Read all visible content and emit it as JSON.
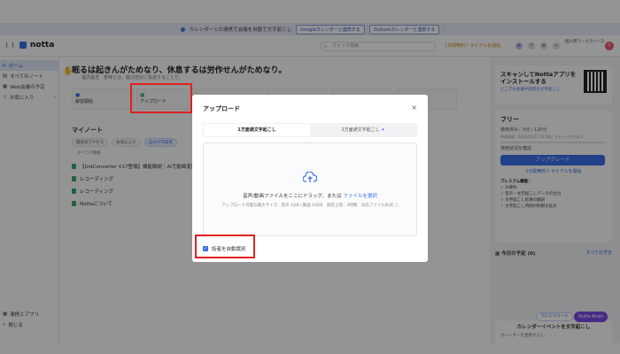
{
  "banner": {
    "text": "カレンダーとの連携で会議を自動で文字起こし",
    "google_btn": "Googleカレンダーと連携する",
    "outlook_btn": "Outlookカレンダーと連携する"
  },
  "topbar": {
    "logo": "notta",
    "search_placeholder": "クイック検索",
    "trial": "1日間無料トライアルを開始",
    "team": "個人用ワークスペース",
    "avatar_letter": "Y"
  },
  "sidebar": {
    "items": [
      {
        "label": "ホーム",
        "icon": "home-icon"
      },
      {
        "label": "すべてのノート",
        "icon": "notes-icon"
      },
      {
        "label": "Web会議の予定",
        "icon": "calendar-icon"
      },
      {
        "label": "お気に入り",
        "icon": "star-icon"
      }
    ],
    "bottom": [
      {
        "label": "連携とアプリ",
        "icon": "apps-icon"
      },
      {
        "label": "閉じる",
        "icon": "collapse-icon"
      }
    ]
  },
  "main": {
    "quote": "眠るは起きんがためなり、休息するは労作せんがためなり。",
    "quote_sub": "福沢諭吉　意味とは、遊び自分に投資することだ。",
    "actions": [
      {
        "label": "録音開始",
        "icon": "mic-icon"
      },
      {
        "label": "アップロード",
        "icon": "upload-icon"
      }
    ],
    "my_notes_title": "マイノート",
    "filters": [
      "最近のアクセス",
      "お気に入り",
      "自分が作成者"
    ],
    "all_label": "すべての種類",
    "notes": [
      "【UniConverter V17登場】機能解説｜AIで動画変換・編集",
      "レコーディング",
      "レコーディング",
      "Nottaについて"
    ]
  },
  "rpanel": {
    "scan_title": "スキャンしてNottaアプリをインストールする",
    "scan_sub": "どこでも会議や録音を文字起こし",
    "plan": "フリー",
    "usage": "使用済み：0分 / 120分",
    "usage_sub": "時間制限：2026/01/27 23:59に リセットされます",
    "usage_check": "使用状況を確認",
    "upgrade": "アップグレード",
    "trial_link": "1日間無料トライアルを開始",
    "premium_title": "プレミアム機能：",
    "features": [
      "AI要約",
      "音声・文字起こしデータの出力",
      "文字起こし結果の翻訳",
      "文字起こし時間の制限を拡大"
    ],
    "today": "今日の予定",
    "today_count": "(0)",
    "today_all": "すべての予定",
    "cal_title": "カレンダーイベントを文字起こし",
    "cal_sub": "カレンダーを連携すると、",
    "scroll_btn": "下にスクロール",
    "brain_btn": "Notta Brain"
  },
  "modal": {
    "title": "アップロード",
    "tabs": [
      {
        "label": "1方面通文字起こし",
        "active": true
      },
      {
        "label": "2方面通文字起こし",
        "active": false
      }
    ],
    "drop_main_prefix": "音声/動画ファイルをここにドラッグ、または",
    "drop_link": "ファイルを選択",
    "drop_limits": "アップロード可能な最大サイズ：音声 1GB / 動画 10GB　録音上限：3時間　対応ファイル形式",
    "speaker_label": "話者を自動識別",
    "speaker_checked": true
  }
}
